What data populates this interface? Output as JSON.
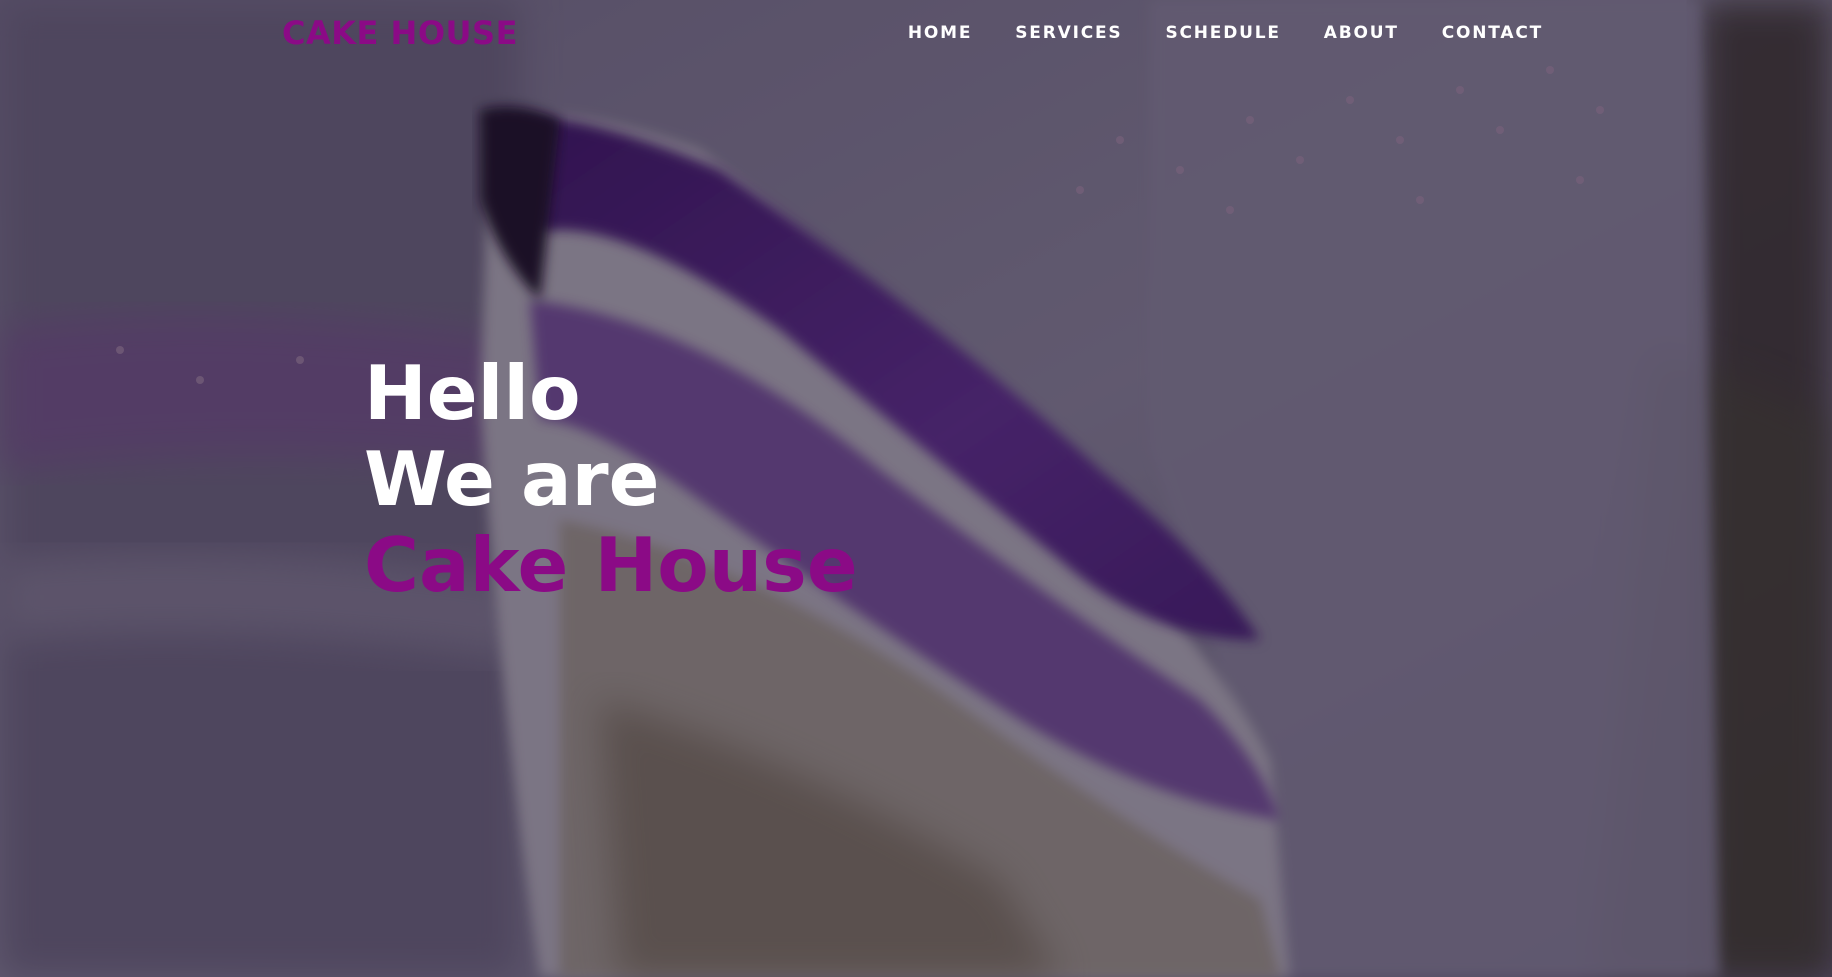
{
  "colors": {
    "accent": "#8b0a86",
    "nav_text": "#ffffff",
    "overlay": "rgba(28,20,38,0.55)"
  },
  "nav": {
    "brand": "CAKE HOUSE",
    "links": [
      {
        "label": "HOME"
      },
      {
        "label": "SERVICES"
      },
      {
        "label": "SCHEDULE"
      },
      {
        "label": "ABOUT"
      },
      {
        "label": "CONTACT"
      }
    ]
  },
  "hero": {
    "background_image": "purple-layer-cake-slice",
    "line1": "Hello",
    "line2": "We are",
    "line3": "Cake House"
  }
}
